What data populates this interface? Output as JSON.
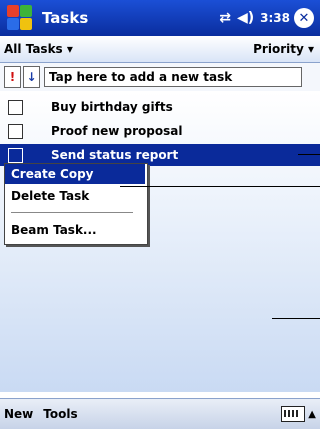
{
  "titlebar": {
    "app_title": "Tasks",
    "time": "3:38",
    "close_label": "✕"
  },
  "filterbar": {
    "category": "All Tasks ▾",
    "sort": "Priority ▾"
  },
  "entrybar": {
    "priority_glyph": "!",
    "sort_glyph": "↓",
    "add_task_text": "Tap here to add a new task"
  },
  "tasks": [
    {
      "label": "Buy birthday gifts"
    },
    {
      "label": "Proof new proposal"
    },
    {
      "label": "Send status report"
    }
  ],
  "context_menu": {
    "items": [
      "Create Copy",
      "Delete Task",
      "Beam Task..."
    ]
  },
  "menubar": {
    "new_label": "New",
    "tools_label": "Tools"
  }
}
